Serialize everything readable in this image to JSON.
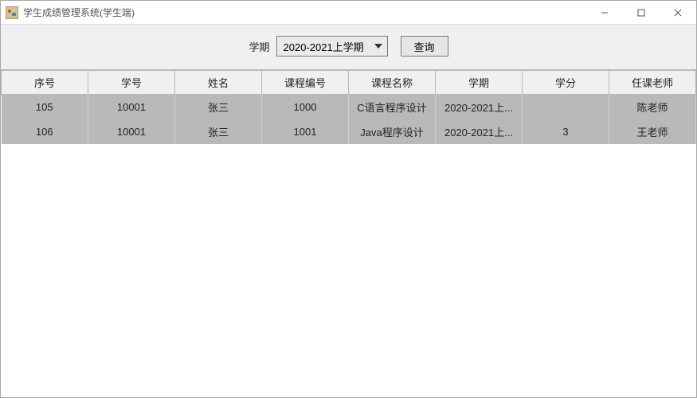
{
  "window": {
    "title": "学生成绩管理系统(学生端)"
  },
  "toolbar": {
    "semester_label": "学期",
    "semester_value": "2020-2021上学期",
    "query_label": "查询"
  },
  "table": {
    "columns": [
      "序号",
      "学号",
      "姓名",
      "课程编号",
      "课程名称",
      "学期",
      "学分",
      "任课老师"
    ],
    "rows": [
      {
        "c0": "105",
        "c1": "10001",
        "c2": "张三",
        "c3": "1000",
        "c4": "C语言程序设计",
        "c5": "2020-2021上...",
        "c6": "",
        "c7": "陈老师"
      },
      {
        "c0": "106",
        "c1": "10001",
        "c2": "张三",
        "c3": "1001",
        "c4": "Java程序设计",
        "c5": "2020-2021上...",
        "c6": "3",
        "c7": "王老师"
      }
    ]
  }
}
